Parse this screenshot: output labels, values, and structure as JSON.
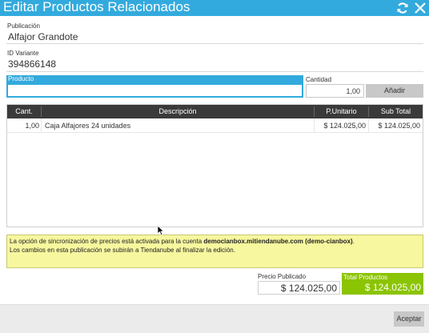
{
  "window": {
    "title": "Editar Productos Relacionados",
    "icons": [
      "refresh-icon",
      "close-icon"
    ]
  },
  "publicacion": {
    "label": "Publicación",
    "value": "Alfajor Grandote"
  },
  "id_variante": {
    "label": "ID Variante",
    "value": "394866148"
  },
  "producto": {
    "label": "Producto",
    "value": ""
  },
  "cantidad": {
    "label": "Cantidad",
    "value": "1,00"
  },
  "add_button": "Añadir",
  "table": {
    "headers": {
      "cant": "Cant.",
      "descripcion": "Descripción",
      "unitario": "P.Unitario",
      "subtotal": "Sub Total"
    },
    "rows": [
      {
        "cant": "1,00",
        "descripcion": "Caja Alfajores 24 unidades",
        "unitario": "$ 124.025,00",
        "subtotal": "$ 124.025,00"
      }
    ]
  },
  "notice": {
    "line1_prefix": "La opción de sincronización de precios está activada para la cuenta ",
    "line1_account": "democianbox.mitiendanube.com (demo-cianbox)",
    "line1_suffix": ".",
    "line2": "Los cambios en esta publicación se subirán a Tiendanube al finalizar la edición."
  },
  "precio_publicado": {
    "label": "Precio Publicado",
    "value": "$ 124.025,00"
  },
  "total_productos": {
    "label": "Total Productos",
    "value": "$ 124.025,00"
  },
  "accept_button": "Aceptar",
  "colors": {
    "accent": "#33aadd",
    "total_bg": "#8bc400",
    "notice_bg": "#f7f79f",
    "table_header": "#3a3a3a"
  }
}
